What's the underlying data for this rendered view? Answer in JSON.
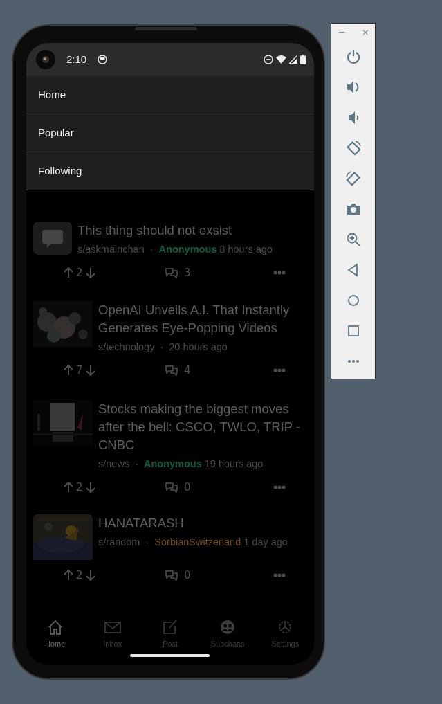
{
  "status_bar": {
    "time": "2:10"
  },
  "menu": [
    {
      "label": "Home"
    },
    {
      "label": "Popular"
    },
    {
      "label": "Following"
    }
  ],
  "posts": [
    {
      "thumbnail": {
        "kind": "icon"
      },
      "title": "This thing should not exsist",
      "subchan": "s/askmainchan",
      "separator": "·",
      "author": {
        "name": "Anonymous",
        "color": "#0f5b3b",
        "bold": true
      },
      "time": "8 hours ago",
      "votes": "2",
      "comments": "3"
    },
    {
      "title": "OpenAI Unveils A.I. That Instantly Generates Eye-Popping Videos",
      "subchan": "s/technology",
      "separator": "·",
      "time": "20 hours ago",
      "votes": "7",
      "comments": "4"
    },
    {
      "title": "Stocks making the biggest moves after the bell: CSCO, TWLO, TRIP - CNBC",
      "subchan": "s/news",
      "separator": "·",
      "author": {
        "name": "Anonymous",
        "color": "#0f5b3b",
        "bold": true
      },
      "time": "19 hours ago",
      "votes": "2",
      "comments": "0"
    },
    {
      "title": "HANATARASH",
      "subchan": "s/random",
      "separator": "·",
      "author": {
        "name": "SorbianSwitzerland",
        "color": "#6b4a12",
        "bold": false
      },
      "time": "1 day ago",
      "votes": "2",
      "comments": "0"
    }
  ],
  "bottom_nav": [
    {
      "label": "Home",
      "selected": true
    },
    {
      "label": "Inbox",
      "selected": false
    },
    {
      "label": "Post",
      "selected": false
    },
    {
      "label": "Subchans",
      "selected": false
    },
    {
      "label": "Settings",
      "selected": false
    }
  ],
  "emulator_toolbar": {
    "minimize": "−",
    "close": "×"
  }
}
